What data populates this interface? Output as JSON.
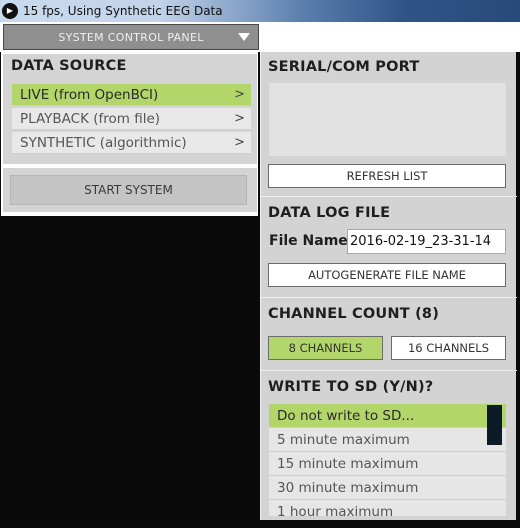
{
  "window": {
    "title": "15 fps, Using Synthetic EEG Data",
    "icon": "play-icon"
  },
  "control_panel": {
    "label": "SYSTEM CONTROL PANEL",
    "icon": "triangle-down-icon"
  },
  "data_source": {
    "title": "DATA SOURCE",
    "items": [
      {
        "label": "LIVE (from OpenBCI)",
        "chevron": ">",
        "selected": true
      },
      {
        "label": "PLAYBACK (from file)",
        "chevron": ">",
        "selected": false
      },
      {
        "label": "SYNTHETIC (algorithmic)",
        "chevron": ">",
        "selected": false
      }
    ],
    "start_label": "START SYSTEM"
  },
  "serial": {
    "title": "SERIAL/COM PORT",
    "refresh_label": "REFRESH LIST"
  },
  "datalog": {
    "title": "DATA LOG FILE",
    "file_label": "File Name",
    "file_value": "2016-02-19_23-31-14",
    "autogen_label": "AUTOGENERATE FILE NAME"
  },
  "channels": {
    "title": "CHANNEL COUNT (8)",
    "opt8": "8 CHANNELS",
    "opt16": "16 CHANNELS",
    "selected": "8 CHANNELS"
  },
  "sd": {
    "title": "WRITE TO SD (Y/N)?",
    "items": [
      {
        "label": "Do not write to SD...",
        "selected": true
      },
      {
        "label": "5 minute maximum",
        "selected": false
      },
      {
        "label": "15 minute maximum",
        "selected": false
      },
      {
        "label": "30 minute maximum",
        "selected": false
      },
      {
        "label": "1 hour maximum",
        "selected": false
      }
    ]
  },
  "colors": {
    "accent_green": "#b3d66b",
    "panel_gray": "#d3d3d3",
    "scrollbar_thumb": "#0d1b28"
  }
}
